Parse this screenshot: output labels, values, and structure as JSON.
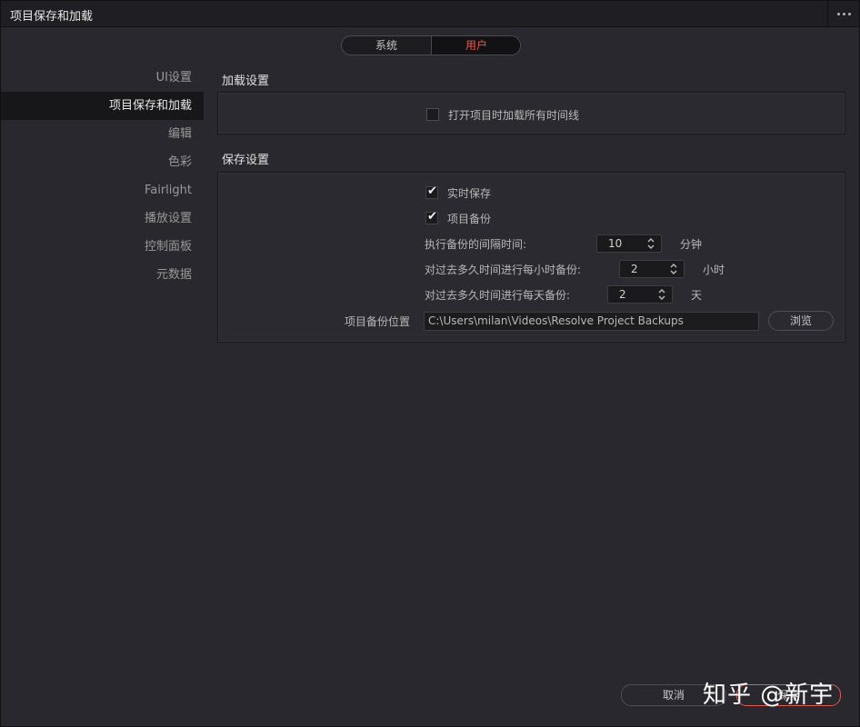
{
  "window": {
    "title": "项目保存和加载"
  },
  "tabs": [
    {
      "label": "系统",
      "active": false
    },
    {
      "label": "用户",
      "active": true
    }
  ],
  "sidebar": {
    "items": [
      {
        "label": "UI设置"
      },
      {
        "label": "项目保存和加载",
        "active": true
      },
      {
        "label": "编辑"
      },
      {
        "label": "色彩"
      },
      {
        "label": "Fairlight"
      },
      {
        "label": "播放设置"
      },
      {
        "label": "控制面板"
      },
      {
        "label": "元数据"
      }
    ]
  },
  "load_settings": {
    "title": "加载设置",
    "open_all_timelines": {
      "label": "打开项目时加载所有时间线",
      "checked": false
    }
  },
  "save_settings": {
    "title": "保存设置",
    "live_save": {
      "label": "实时保存",
      "checked": true
    },
    "project_backup": {
      "label": "项目备份",
      "checked": true
    },
    "backup_interval": {
      "label": "执行备份的间隔时间:",
      "value": "10",
      "unit": "分钟"
    },
    "hourly_backup": {
      "label": "对过去多久时间进行每小时备份:",
      "value": "2",
      "unit": "小时"
    },
    "daily_backup": {
      "label": "对过去多久时间进行每天备份:",
      "value": "2",
      "unit": "天"
    },
    "backup_location": {
      "label": "项目备份位置",
      "value": "C:\\Users\\milan\\Videos\\Resolve Project Backups"
    },
    "browse_label": "浏览"
  },
  "footer": {
    "cancel_label": "取消",
    "save_label": "保存"
  },
  "watermark": "知乎 @新宇",
  "colors": {
    "accent": "#e25a4a",
    "background": "#28282e"
  }
}
